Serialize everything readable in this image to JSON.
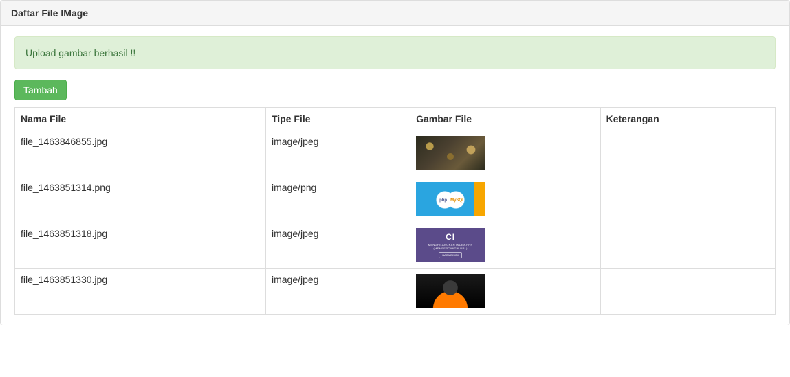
{
  "panel": {
    "title": "Daftar File IMage"
  },
  "alert": {
    "message": "Upload gambar berhasil !!"
  },
  "buttons": {
    "add": "Tambah"
  },
  "table": {
    "headers": {
      "name": "Nama File",
      "type": "Tipe File",
      "image": "Gambar File",
      "note": "Keterangan"
    },
    "rows": [
      {
        "name": "file_1463846855.jpg",
        "type": "image/jpeg",
        "note": ""
      },
      {
        "name": "file_1463851314.png",
        "type": "image/png",
        "note": ""
      },
      {
        "name": "file_1463851318.jpg",
        "type": "image/jpeg",
        "note": ""
      },
      {
        "name": "file_1463851330.jpg",
        "type": "image/jpeg",
        "note": ""
      }
    ]
  }
}
